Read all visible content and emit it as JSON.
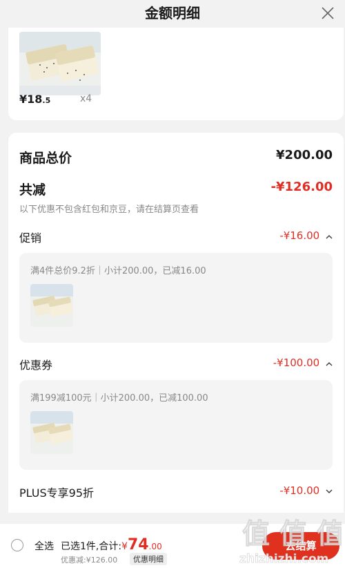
{
  "header": {
    "title": "金额明细"
  },
  "product": {
    "price_main": "¥18",
    "price_decimal": ".5",
    "qty": "x4"
  },
  "summary": {
    "total_label": "商品总价",
    "total_value": "¥200.00",
    "discount_label": "共减",
    "discount_value": "-¥126.00",
    "note": "以下优惠不包含红包和京豆，请在结算页查看"
  },
  "promotion": {
    "label": "促销",
    "value": "-¥16.00",
    "desc": "满4件总价9.2折｜小计200.00，已减16.00"
  },
  "coupon": {
    "label": "优惠券",
    "value": "-¥100.00",
    "desc": "满199减100元｜小计200.00，已减100.00"
  },
  "plus": {
    "label": "PLUS专享95折",
    "value": "-¥10.00"
  },
  "footer": {
    "select_all": "全选",
    "selected_text": "已选1件,合计:",
    "currency": "¥",
    "total_int": "74",
    "total_dec": ".00",
    "discount_line": "优惠减:¥126.00",
    "detail_chip": "优惠明细",
    "checkout": "去结算"
  },
  "watermark": {
    "text": "值 值 值",
    "site": "zhizhizhi.com"
  },
  "colors": {
    "accent": "#e02e24",
    "background": "#f2f2f2"
  }
}
